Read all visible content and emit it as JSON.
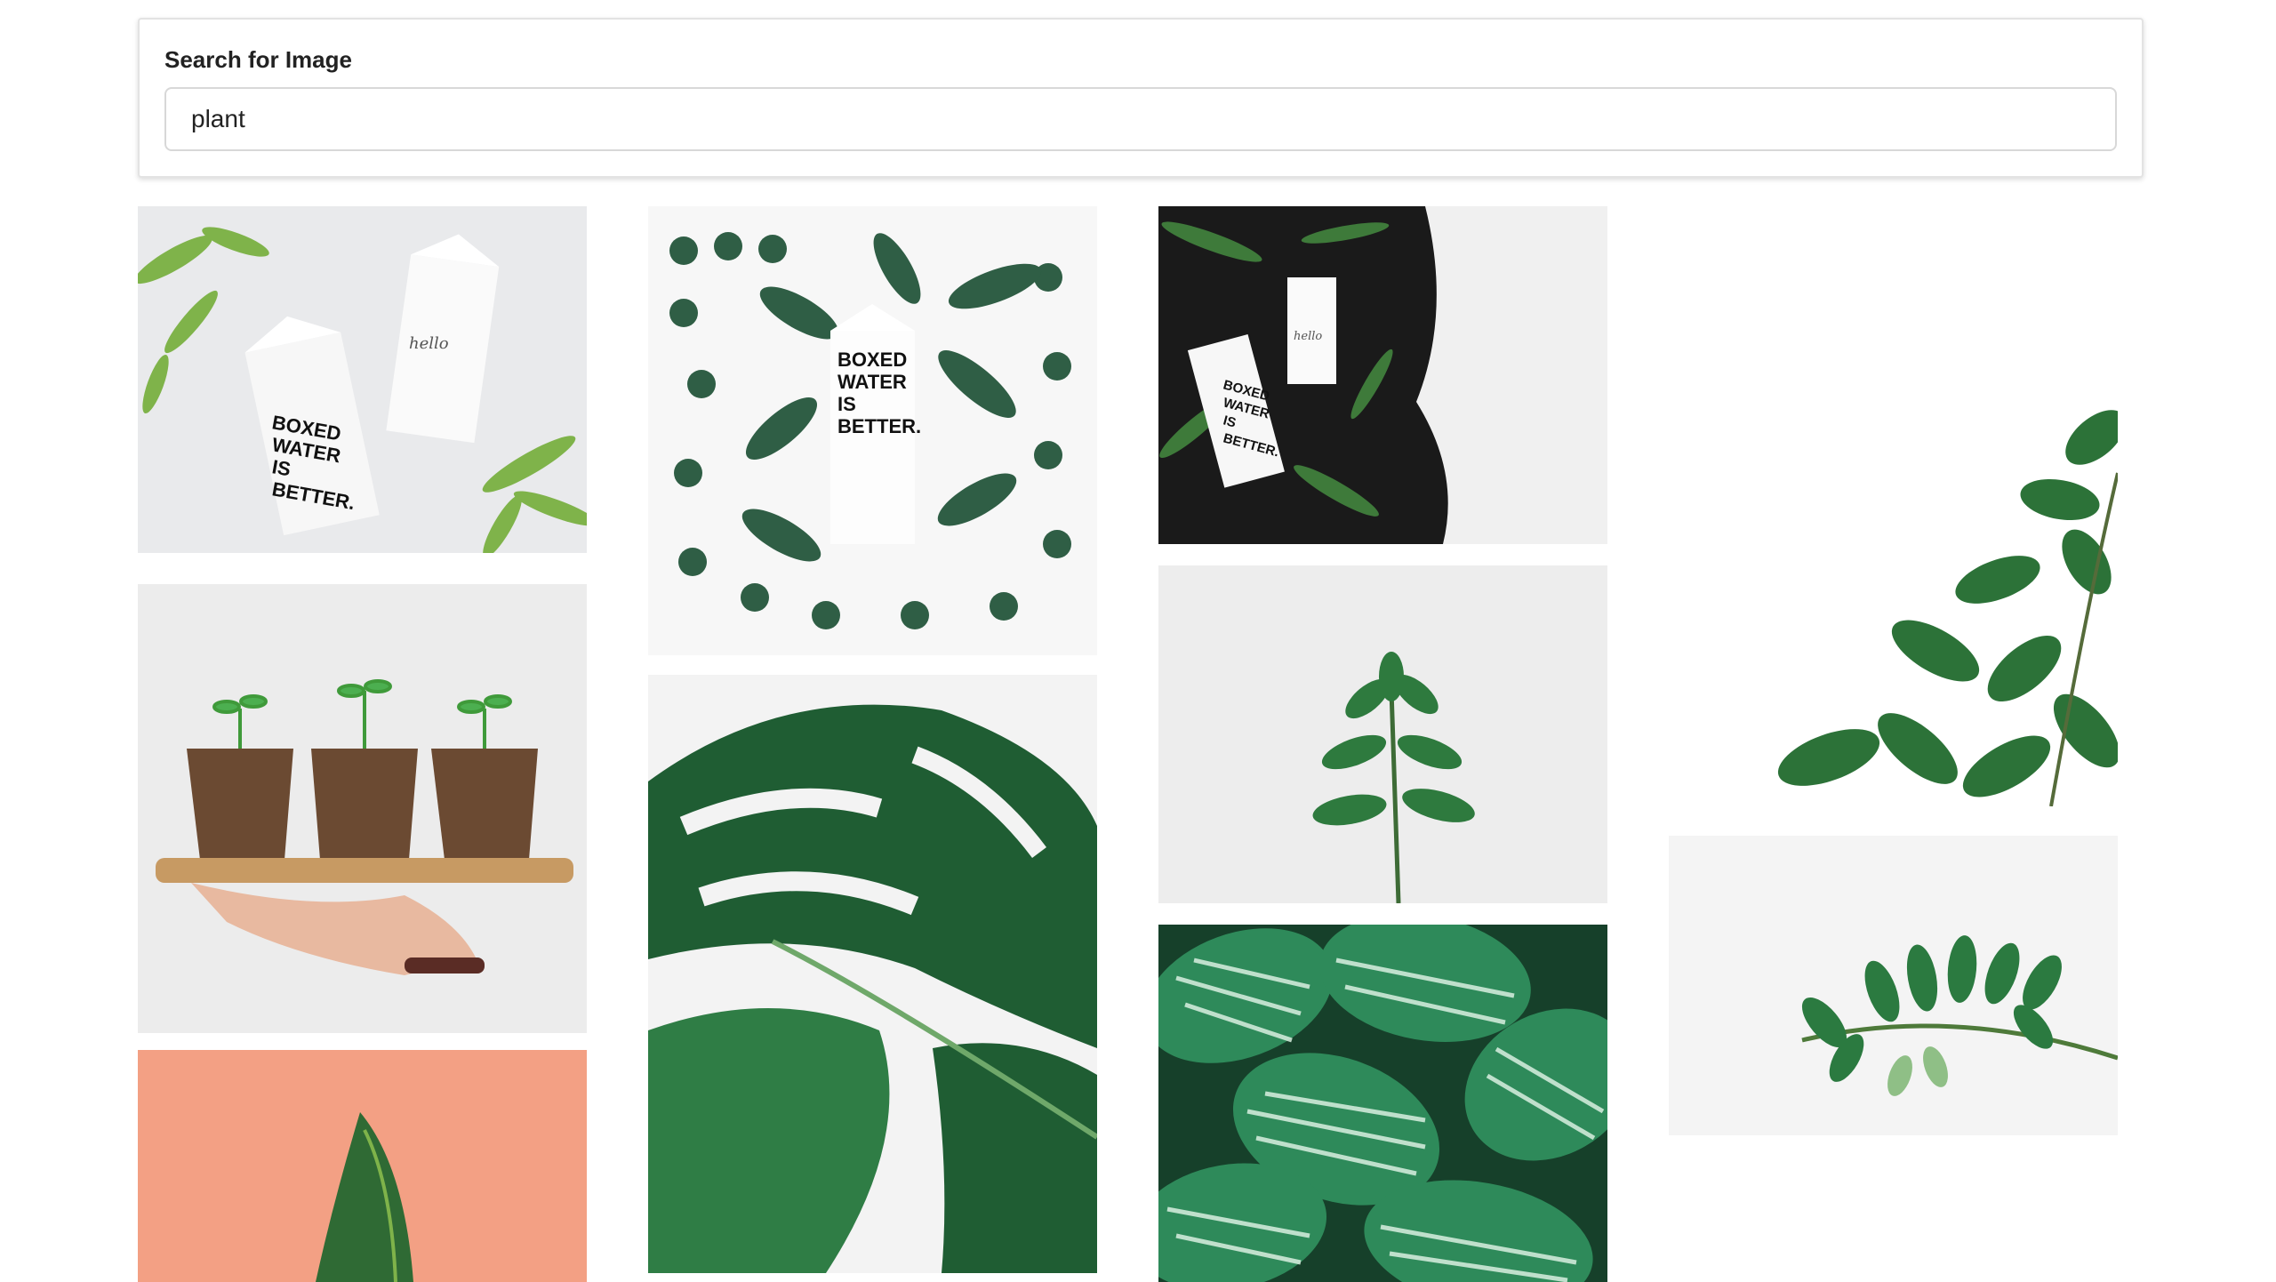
{
  "search": {
    "label": "Search for Image",
    "value": "plant"
  },
  "results": [
    {
      "name": "boxed-water-cartons-with-greenery",
      "text_on_image": "BOXED WATER IS BETTER.",
      "secondary_text": "hello"
    },
    {
      "name": "boxed-water-carton-surrounded-by-leaves",
      "text_on_image": "BOXED WATER IS BETTER."
    },
    {
      "name": "boxed-water-cartons-on-soil",
      "text_on_image": "BOXED WATER IS BETTER.",
      "secondary_text": "hello"
    },
    {
      "name": "ficus-plant-on-white"
    },
    {
      "name": "seedlings-in-pots-on-tray"
    },
    {
      "name": "monstera-leaves"
    },
    {
      "name": "small-green-plant-on-white"
    },
    {
      "name": "zz-plant-branch"
    },
    {
      "name": "succulent-on-coral-background"
    },
    {
      "name": "striped-calathea-leaves"
    }
  ],
  "colors": {
    "leaf_dark": "#1f5d33",
    "leaf_mid": "#2f7d45",
    "leaf_light": "#7fb34a",
    "coral": "#f3a084",
    "soil": "#1a1a1a"
  }
}
